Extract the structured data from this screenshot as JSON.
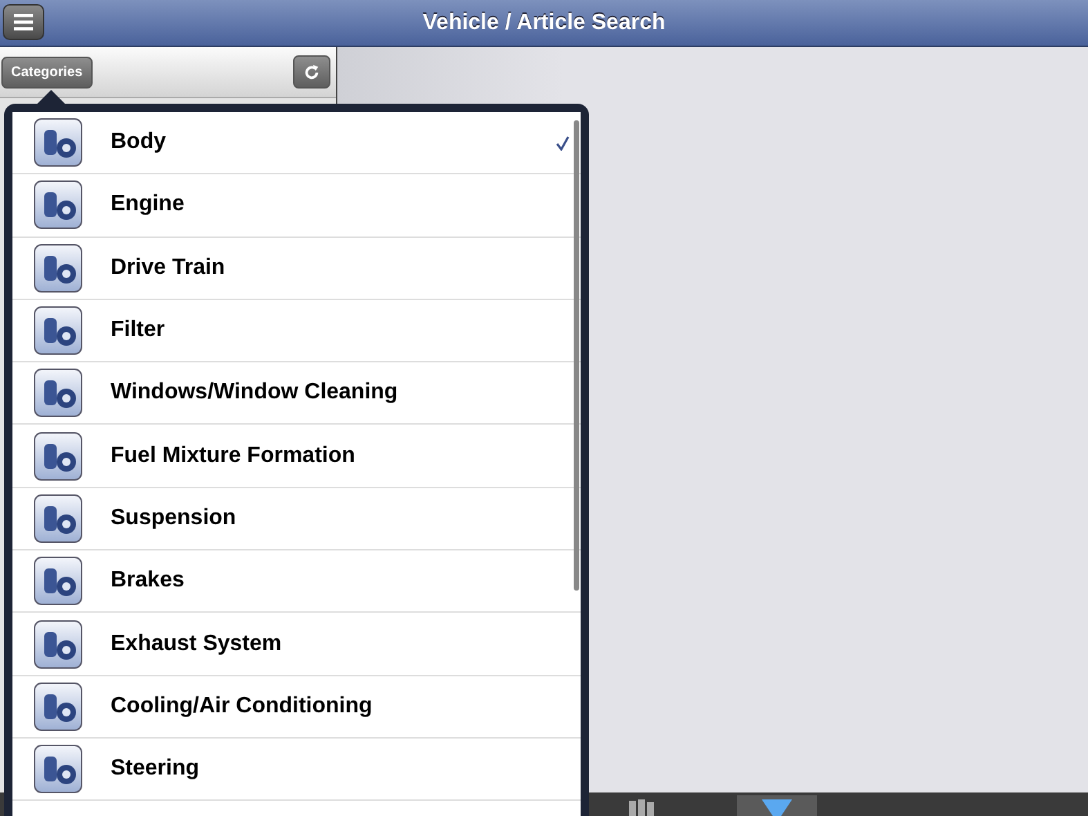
{
  "header": {
    "title": "Vehicle / Article Search"
  },
  "sidebar": {
    "categories_button": "Categories"
  },
  "popover": {
    "items": [
      {
        "label": "Body",
        "selected": true
      },
      {
        "label": "Engine",
        "selected": false
      },
      {
        "label": "Drive Train",
        "selected": false
      },
      {
        "label": "Filter",
        "selected": false
      },
      {
        "label": "Windows/Window Cleaning",
        "selected": false
      },
      {
        "label": "Fuel Mixture Formation",
        "selected": false
      },
      {
        "label": "Suspension",
        "selected": false
      },
      {
        "label": "Brakes",
        "selected": false
      },
      {
        "label": "Exhaust System",
        "selected": false
      },
      {
        "label": "Cooling/Air Conditioning",
        "selected": false
      },
      {
        "label": "Steering",
        "selected": false
      }
    ]
  },
  "toolbar_tabs": [
    {
      "selected": false
    },
    {
      "selected": true
    }
  ]
}
